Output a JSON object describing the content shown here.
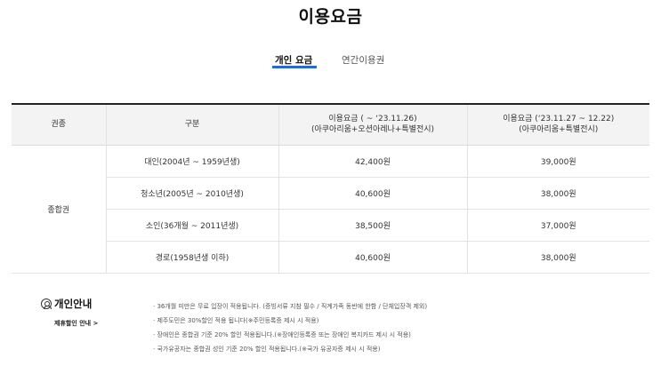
{
  "page": {
    "title": "이용요금"
  },
  "tabs": [
    {
      "label": "개인 요금",
      "active": true
    },
    {
      "label": "연간이용권",
      "active": false
    }
  ],
  "colors": {
    "accent": "#2a67d6",
    "header_bg": "#f3f3f3",
    "header_rule": "#222222"
  },
  "table": {
    "headers": {
      "ticket_type": "권종",
      "category": "구분",
      "price_a": {
        "line1": "이용요금 ( ~ ‘23.11.26)",
        "line2": "(아쿠아리움+오션아레나+특별전시)"
      },
      "price_b": {
        "line1": "이용요금 (‘23.11.27 ~ 12.22)",
        "line2": "(아쿠아리움+특별전시)"
      }
    },
    "ticket_type": "종합권",
    "rows": [
      {
        "category": "대인(2004년 ~ 1959년생)",
        "price_a": "42,400원",
        "price_b": "39,000원"
      },
      {
        "category": "청소년(2005년 ~ 2010년생)",
        "price_a": "40,600원",
        "price_b": "38,000원"
      },
      {
        "category": "소인(36개월 ~ 2011년생)",
        "price_a": "38,500원",
        "price_b": "37,000원"
      },
      {
        "category": "경로(1958년생 이하)",
        "price_a": "40,600원",
        "price_b": "38,000원"
      }
    ]
  },
  "info": {
    "icon": "person-circle-icon",
    "title": "개인안내",
    "link": "제휴할인 안내 >",
    "notes": [
      "· 36개월 미만은 무료 입장이 적용됩니다. (증빙서류 지참 필수 / 직계가족 동반에 한함 / 단체입장객 제외)",
      "· 제주도민은 30%할인 적용 됩니다(※주민등록증 제시 시 적용)",
      "· 장애인은 종합권 기준 20% 할인 적용됩니다.(※장애인등록증 또는 장애인 복지카드 제시 시 적용)",
      "· 국가유공자는 종합권 성인 기준 20% 할인 적용됩니다.(※국가 유공자증 제시 시 적용)"
    ]
  }
}
